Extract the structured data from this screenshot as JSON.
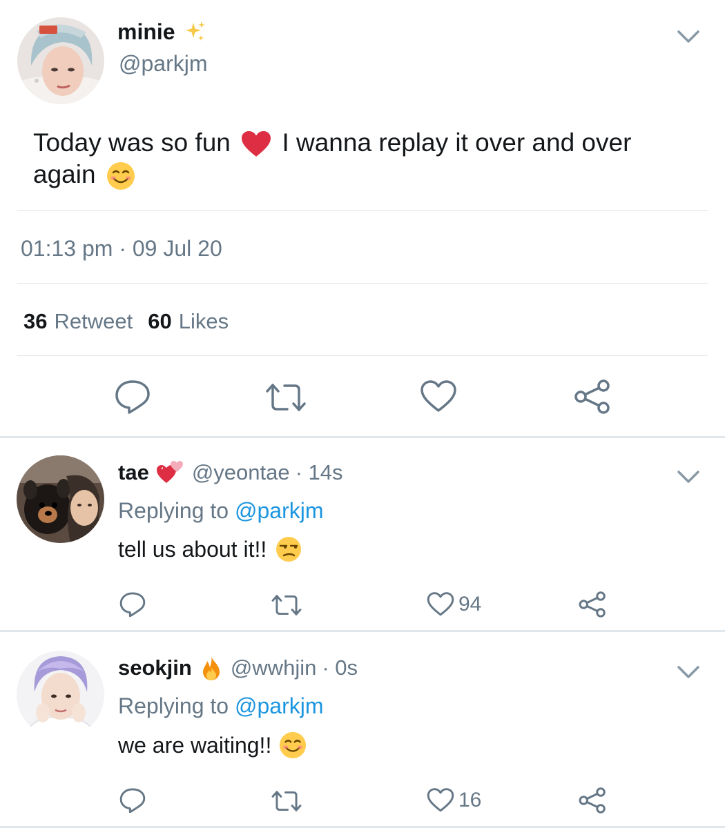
{
  "main_tweet": {
    "display_name": "minie",
    "handle": "@parkjm",
    "text_part1": "Today was so fun",
    "text_part2": "I wanna replay it over and over",
    "text_part3": "again",
    "timestamp": "01:13 pm · 09 Jul 20",
    "retweet_count": "36",
    "retweet_label": "Retweet",
    "likes_count": "60",
    "likes_label": "Likes",
    "emojis": [
      "sparkles",
      "red-heart",
      "smiling-face"
    ]
  },
  "replies": [
    {
      "display_name": "tae",
      "handle": "@yeontae",
      "time": "· 14s",
      "replying_prefix": "Replying to",
      "replying_handle": "@parkjm",
      "text": "tell us about it!!",
      "like_count": "94",
      "emojis": [
        "two-hearts",
        "unamused-face"
      ]
    },
    {
      "display_name": "seokjin",
      "handle": "@wwhjin",
      "time": "· 0s",
      "replying_prefix": "Replying to",
      "replying_handle": "@parkjm",
      "text": "we are waiting!!",
      "like_count": "16",
      "emojis": [
        "fire",
        "smiling-face"
      ]
    }
  ],
  "colors": {
    "text": "#14171a",
    "secondary": "#657786",
    "link": "#1b95e0",
    "icon": "#657786",
    "divider": "#e6ecf0"
  }
}
